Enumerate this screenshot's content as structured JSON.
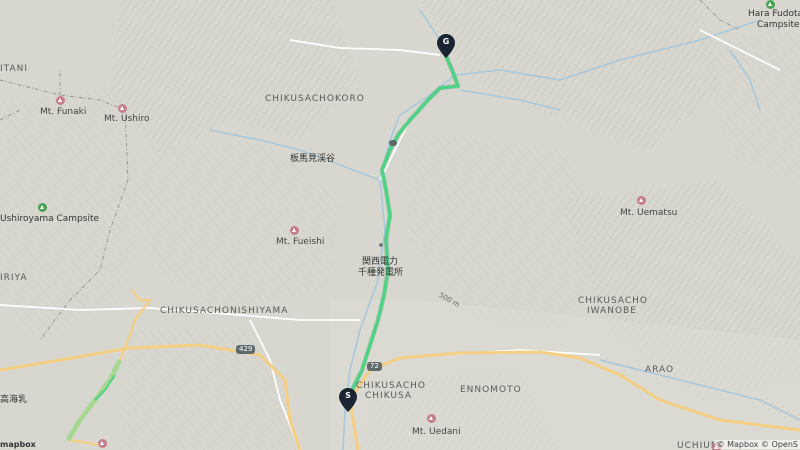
{
  "colors": {
    "land": "#d8d7cf",
    "terrain_shadow": "#bfbdb4",
    "river": "#a7c8dd",
    "road_major": "#f4cf83",
    "road_minor": "#ffffff",
    "route": "#4cd484",
    "trail": "#8fd88a",
    "marker": "#1b2433",
    "peak_icon": "#c57e8d",
    "camp_icon": "#47a455",
    "boundary": "#9a8f95"
  },
  "areas": {
    "chikusachokoro": "CHIKUSACHOKORO",
    "chikusachonishiyama": "CHIKUSACHONISHIYAMA",
    "chikusacho_iwanobe_1": "CHIKUSACHO",
    "chikusacho_iwanobe_2": "IWANOBE",
    "chikusacho_chikusa_1": "CHIKUSACHO",
    "chikusacho_chikusa_2": "CHIKUSA",
    "ennomoto": "ENNOMOTO",
    "arao": "ARAO",
    "uchiumi": "UCHIUMI",
    "itani": "ITANI",
    "iriya": "IRIYA"
  },
  "peaks": {
    "funaki": "Mt. Funaki",
    "ushiro": "Mt. Ushiro",
    "fueishi": "Mt. Fueishi",
    "uematsu": "Mt. Uematsu",
    "uedani": "Mt. Uedani"
  },
  "campsites": {
    "ushiroyama": "Ushiroyama Campsite",
    "hara_1": "Hara Fudotaki",
    "hara_2": "Campsite"
  },
  "japanese": {
    "valley": "板馬見渓谷",
    "power_1": "関西電力",
    "power_2": "千種発電所",
    "left_edge": "高海乳"
  },
  "roads": {
    "route_429": "429",
    "route_72": "72"
  },
  "elevation_label": "500 m",
  "markers": {
    "start": "S",
    "goal": "G"
  },
  "attribution": {
    "logo": "mapbox",
    "credits": "© Mapbox © OpenS"
  }
}
